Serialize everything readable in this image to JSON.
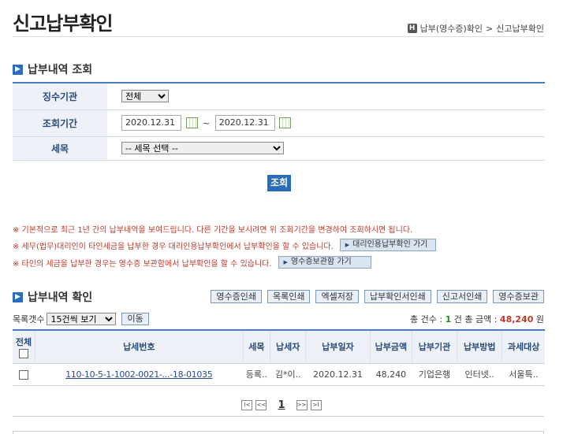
{
  "page": {
    "title": "신고납부확인",
    "breadcrumb": {
      "home_icon": "H",
      "item1": "납부(영수증)확인",
      "sep": ">",
      "item2": "신고납부확인"
    }
  },
  "search": {
    "section_title": "납부내역 조회",
    "agency_label": "징수기관",
    "agency_value": "전체",
    "period_label": "조회기간",
    "date_from": "2020.12.31",
    "tilde": "~",
    "date_to": "2020.12.31",
    "tax_label": "세목",
    "tax_value": "-- 세목 선택 --",
    "search_button": "조회"
  },
  "notices": {
    "n1": "※ 기본적으로 최근 1년 간의 납부내역을 보여드립니다. 다른 기간을 보시려면 위 조회기간을 변경하여 조회하시면 됩니다.",
    "n2": "※ 세무(법무)대리인이 타인세금을 납부한 경우 대리인용납부확인에서 납부확인을 할 수 있습니다.",
    "n2_button": "대리인용납부확인 가기",
    "n3": "※ 타인의 세금을 납부한 경우는 영수증 보관함에서 납부확인을 할 수 있습니다.",
    "n3_button": "영수증보관함 가기"
  },
  "results": {
    "section_title": "납부내역 확인",
    "buttons": [
      "영수증인쇄",
      "목록인쇄",
      "엑셀저장",
      "납부확인서인쇄",
      "신고서인쇄",
      "영수증보관"
    ],
    "list_count_label": "목록갯수",
    "list_count_value": "15건씩 보기",
    "move_button": "이동",
    "total_prefix": "총 건수 :",
    "total_count": "1",
    "total_mid": "건 총 금액 :",
    "total_amount": "48,240",
    "total_suffix": "원",
    "columns": [
      "전체",
      "납세번호",
      "세목",
      "납세자",
      "납부일자",
      "납부금액",
      "납부기관",
      "납부방법",
      "과세대상"
    ],
    "rows": [
      {
        "payno": "110-10-5-1-1002-0021-...-18-01035",
        "tax": "등록..",
        "payer": "김*이..",
        "date": "2020.12.31",
        "amount": "48,240",
        "agency": "기업은행",
        "method": "인터넷..",
        "target": "서울특.."
      }
    ]
  },
  "pager": {
    "first": "I<",
    "prev": "<<",
    "current": "1",
    "next": ">>",
    "last": ">I"
  }
}
